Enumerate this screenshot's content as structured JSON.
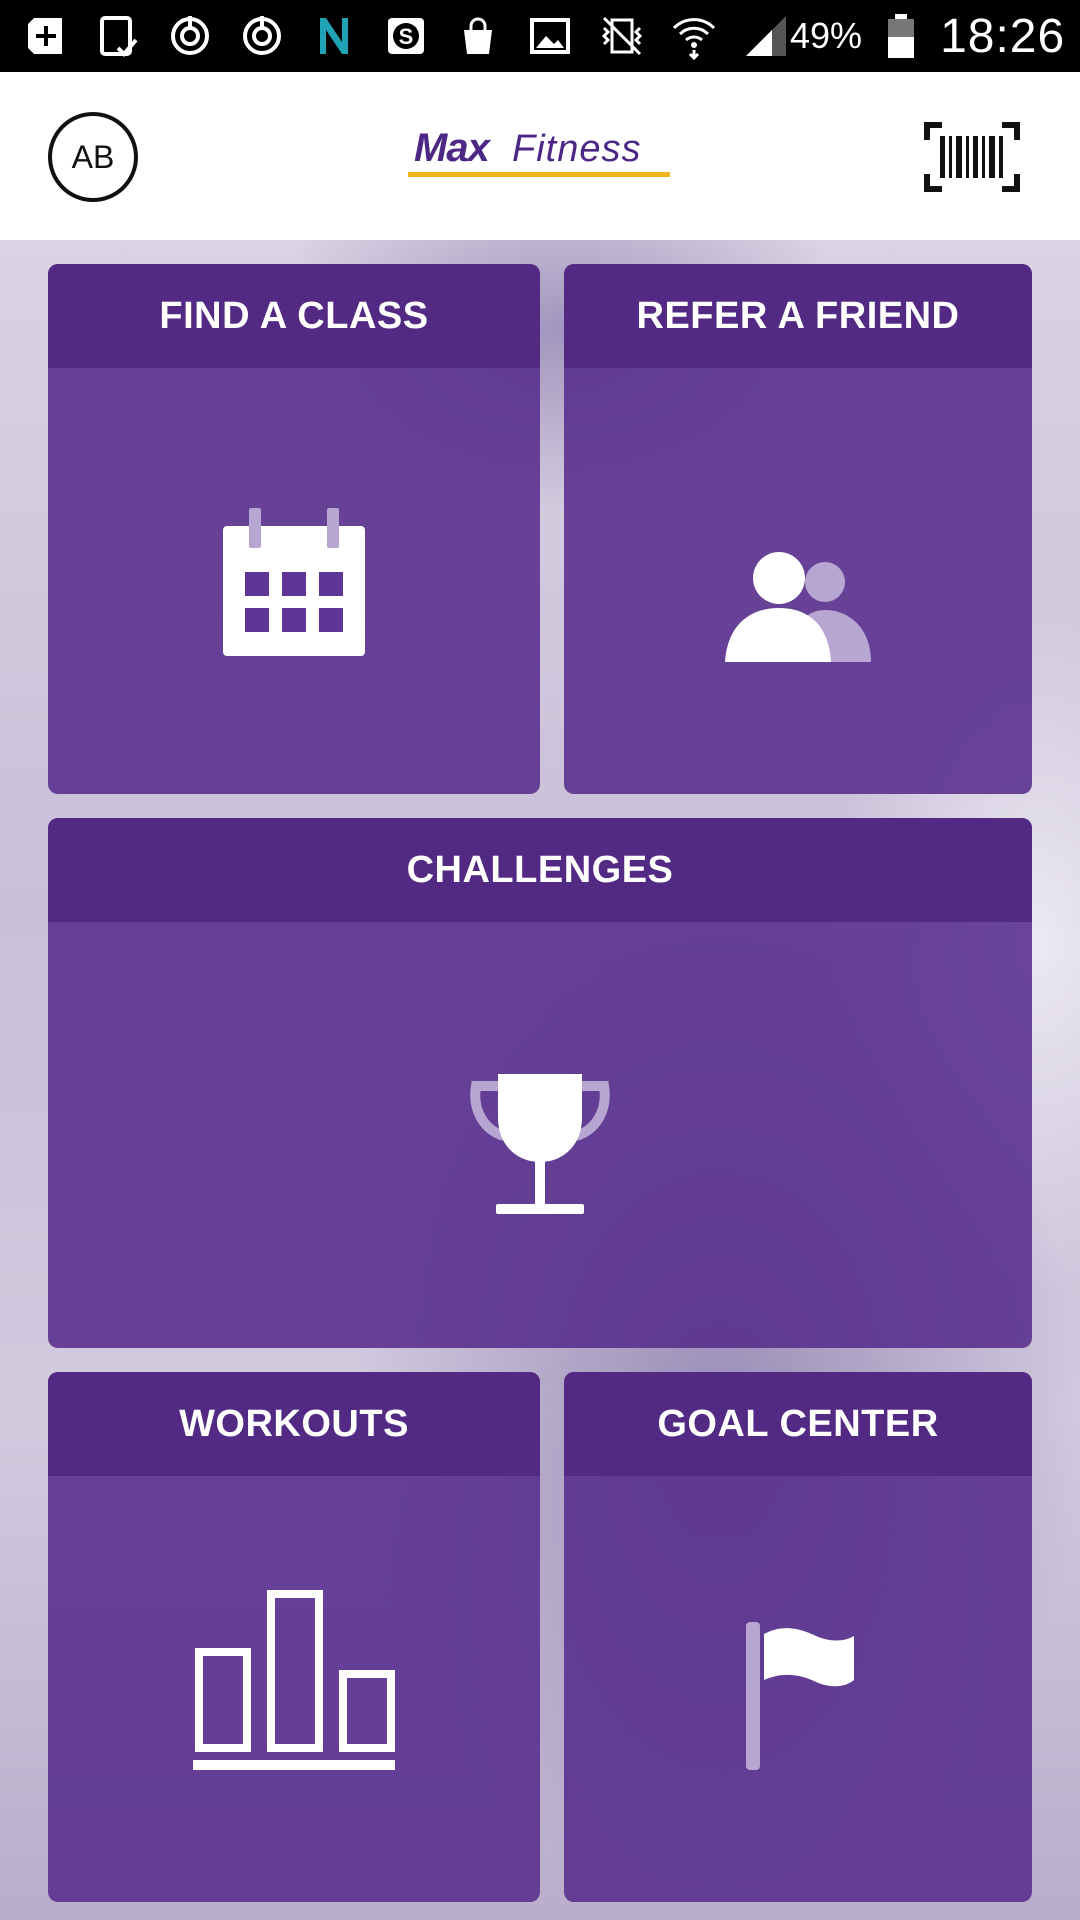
{
  "status_bar": {
    "battery_percent": "49%",
    "time": "18:26",
    "icons": [
      "add-box-icon",
      "tablet-check-icon",
      "sync-icon",
      "sync-icon",
      "n-app-icon",
      "skype-icon",
      "shopping-bag-icon",
      "image-icon",
      "vibrate-mute-icon",
      "wifi-icon",
      "signal-icon",
      "battery-icon"
    ]
  },
  "header": {
    "avatar_initials": "AB",
    "logo_max": "Max",
    "logo_fitness": "Fitness",
    "barcode_icon": "barcode-scan-icon"
  },
  "tiles": [
    {
      "label": "FIND A CLASS",
      "icon": "calendar-icon"
    },
    {
      "label": "REFER A FRIEND",
      "icon": "people-icon"
    },
    {
      "label": "CHALLENGES",
      "icon": "trophy-icon"
    },
    {
      "label": "WORKOUTS",
      "icon": "bar-chart-icon"
    },
    {
      "label": "GOAL CENTER",
      "icon": "flag-icon"
    }
  ],
  "colors": {
    "brand_purple": "#522983",
    "tile_purple": "#5f3596",
    "accent_yellow": "#f2b41a"
  }
}
